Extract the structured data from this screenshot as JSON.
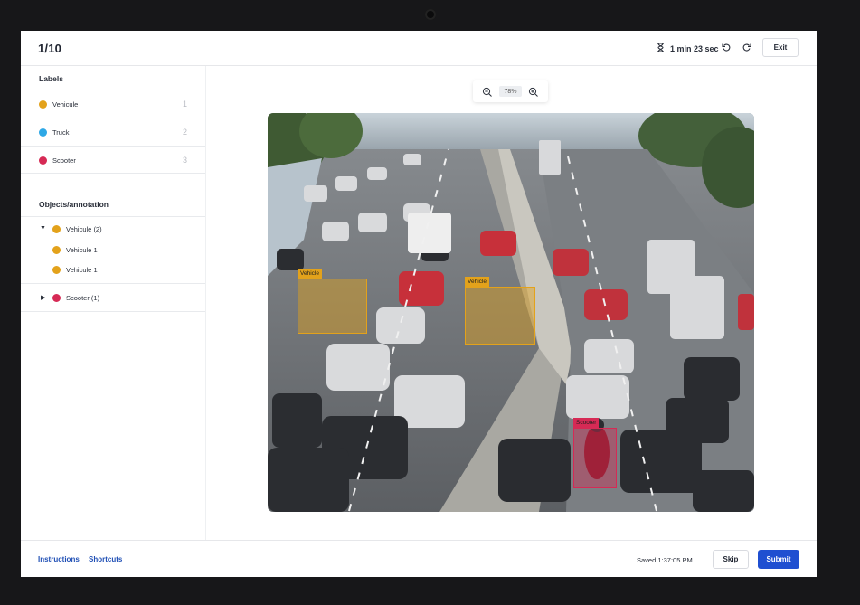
{
  "header": {
    "progress": "1/10",
    "timer": "1 min 23 sec",
    "exit_label": "Exit"
  },
  "labels": {
    "title": "Labels",
    "items": [
      {
        "name": "Vehicule",
        "key": "1",
        "color": "#e3a21b"
      },
      {
        "name": "Truck",
        "key": "2",
        "color": "#2ea8e6"
      },
      {
        "name": "Scooter",
        "key": "3",
        "color": "#d62a55"
      }
    ]
  },
  "objects": {
    "title": "Objects/annotation",
    "groups": [
      {
        "label": "Vehicule (2)",
        "color": "#e3a21b",
        "expanded": true,
        "children": [
          {
            "label": "Vehicule 1"
          },
          {
            "label": "Vehicule 1"
          }
        ]
      },
      {
        "label": "Scooter (1)",
        "color": "#d62a55",
        "expanded": false
      }
    ]
  },
  "zoom": {
    "value": "78%"
  },
  "annotations": [
    {
      "label": "Vehicle",
      "color": "#e3a21b"
    },
    {
      "label": "Vehicle",
      "color": "#e3a21b"
    },
    {
      "label": "Scooter",
      "color": "#d62a55"
    }
  ],
  "footer": {
    "instructions": "Instructions",
    "shortcuts": "Shortcuts",
    "saved": "Saved 1:37:05 PM",
    "skip_label": "Skip",
    "submit_label": "Submit"
  }
}
